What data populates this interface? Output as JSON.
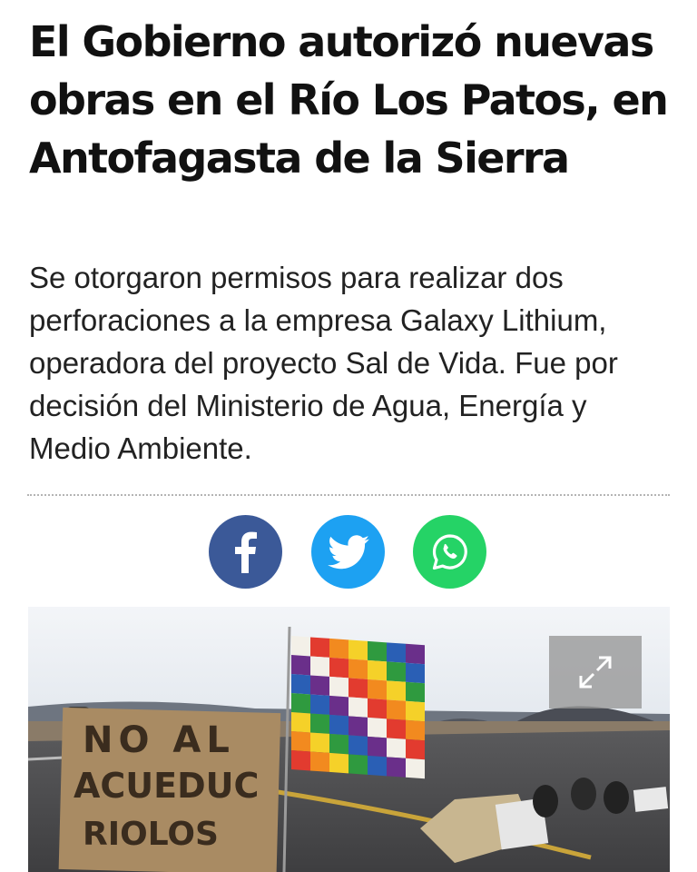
{
  "article": {
    "headline": "El Gobierno autorizó nuevas obras en el Río Los Patos, en Antofagasta de la Sierra",
    "subheadline": "Se otorgaron permisos para realizar dos perforaciones a la empresa Galaxy Lithium, operadora del proyecto Sal de Vida. Fue por decisión del Ministerio de Agua, Energía y Medio Ambiente."
  },
  "share": {
    "buttons": [
      {
        "network": "facebook",
        "icon": "facebook-icon",
        "color": "#3b5998"
      },
      {
        "network": "twitter",
        "icon": "twitter-bird-icon",
        "color": "#1da1f2"
      },
      {
        "network": "whatsapp",
        "icon": "whatsapp-icon",
        "color": "#25d366"
      }
    ]
  },
  "photo": {
    "sign_text": "NO AL ACUEDUCTO RIO LOS PATOS",
    "expand_icon": "expand-icon"
  }
}
